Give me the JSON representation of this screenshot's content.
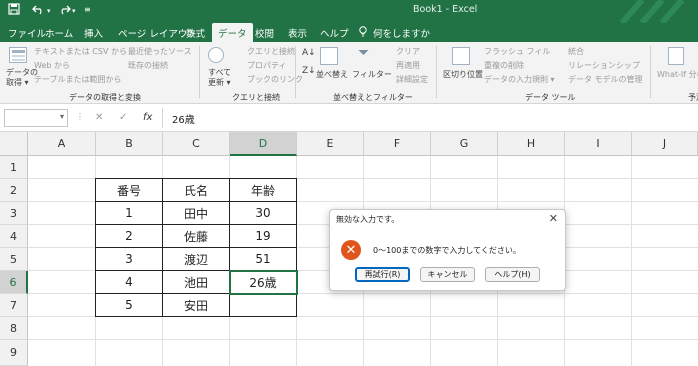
{
  "titlebar": {
    "app_title": "Book1 - Excel",
    "qa_save_icon": "save-icon",
    "qa_undo_icon": "undo-icon",
    "qa_redo_icon": "redo-icon",
    "qa_customize_icon": "customize-quick-access-icon",
    "brand_color": "#217346"
  },
  "tabs": [
    "ファイル",
    "ホーム",
    "挿入",
    "ページ レイアウト",
    "数式",
    "データ",
    "校閲",
    "表示",
    "ヘルプ",
    "何をしますか"
  ],
  "tab_search_icon": "lightbulb-icon",
  "ribbon": {
    "get_transform": {
      "big_label_1": "データの",
      "big_label_2": "取得 ▾",
      "items": [
        "テキストまたは CSV から",
        "Web から",
        "テーブルまたは範囲から",
        "最近使ったソース",
        "既存の接続"
      ],
      "group_name": "データの取得と変換"
    },
    "queries": {
      "big_label_1": "すべて",
      "big_label_2": "更新 ▾",
      "items": [
        "クエリと接続",
        "プロパティ",
        "ブックのリンク"
      ],
      "group_name": "クエリと接続"
    },
    "sort_filter": {
      "sort_label": "並べ替え",
      "filter_label": "フィルター",
      "items": [
        "クリア",
        "再適用",
        "詳細設定"
      ],
      "group_name": "並べ替えとフィルター"
    },
    "data_tools": {
      "big_label": "区切り位置",
      "items": [
        "フラッシュ フィル",
        "重複の削除",
        "データの入力規則 ▾",
        "統合",
        "リレーションシップ",
        "データ モデルの管理"
      ],
      "group_name": "データ ツール"
    },
    "forecast": {
      "big_label": "What-If 分析",
      "group_name": "予測"
    }
  },
  "formula_bar": {
    "name_box": "",
    "cancel_symbol": "✕",
    "enter_symbol": "✓",
    "fx_symbol": "fx",
    "formula": "26歳"
  },
  "columns": [
    "A",
    "B",
    "C",
    "D",
    "E",
    "F",
    "G",
    "H",
    "I",
    "J"
  ],
  "rows": [
    "1",
    "2",
    "3",
    "4",
    "5",
    "6",
    "7",
    "8",
    "9"
  ],
  "table": {
    "headers": [
      "番号",
      "氏名",
      "年齢"
    ],
    "rows": [
      [
        "1",
        "田中",
        "30"
      ],
      [
        "2",
        "佐藤",
        "19"
      ],
      [
        "3",
        "渡辺",
        "51"
      ],
      [
        "4",
        "池田",
        "26歳"
      ],
      [
        "5",
        "安田",
        ""
      ]
    ]
  },
  "dialog": {
    "title": "無効な入力です。",
    "close": "✕",
    "error_icon": "error-icon",
    "error_glyph": "✕",
    "message": "0～100までの数字で入力してください。",
    "buttons": [
      "再試行(R)",
      "キャンセル",
      "ヘルプ(H)"
    ]
  }
}
